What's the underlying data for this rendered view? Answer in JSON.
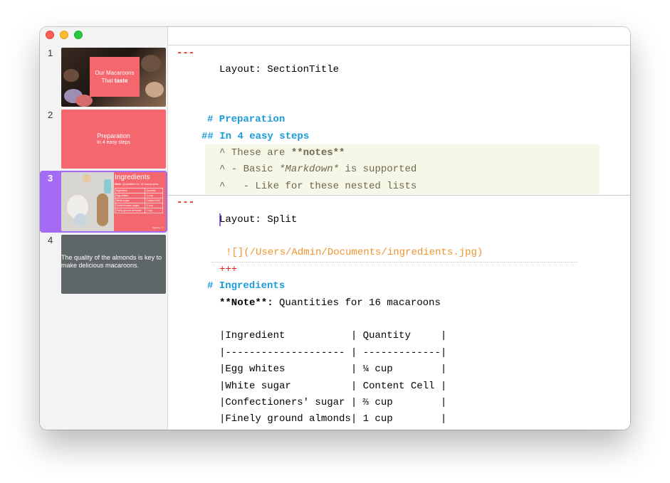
{
  "window": {
    "traffic_lights": [
      "close",
      "minimize",
      "maximize"
    ]
  },
  "slides": [
    {
      "number": "1",
      "title": "Our Macaroons",
      "subtitle_prefix": "That ",
      "subtitle_bold": "taste"
    },
    {
      "number": "2",
      "title": "Preparation",
      "subtitle": "In 4 easy steps"
    },
    {
      "number": "3",
      "title": "Ingredients",
      "note_bold": "Note",
      "note": ": Quantities for 16 macaroons",
      "table": {
        "headers": [
          "Ingredient",
          "Quantity"
        ],
        "rows": [
          [
            "Egg whites",
            "¼ cup"
          ],
          [
            "White sugar",
            "Content Cell"
          ],
          [
            "Confectioners' sugar",
            "⅔ cup"
          ],
          [
            "Finely ground almonds",
            "1 cup"
          ]
        ]
      },
      "footer": "Agenda · 3"
    },
    {
      "number": "4",
      "text": "The quality of the almonds is key to make delicious macaroons."
    }
  ],
  "editor": {
    "l1": "---",
    "l2": "Layout: SectionTitle",
    "l3": "# Preparation",
    "l4": "## In 4 easy steps",
    "n1_pre": "^ These are ",
    "n1_bold": "**notes**",
    "n2_pre": "^ - Basic ",
    "n2_it": "*Markdown*",
    "n2_post": " is supported",
    "n3": "^   - Like for these nested lists",
    "l5": "---",
    "l6": "Layout: Split",
    "l7": "![](/Users/Admin/Documents/ingredients.jpg)",
    "l8": "+++",
    "l9": "# Ingredients",
    "l10_bold": "**Note**:",
    "l10_rest": " Quantities for 16 macaroons",
    "t0": "|Ingredient           | Quantity     |",
    "t1": "|-------------------- | -------------|",
    "t2": "|Egg whites           | ¼ cup        |",
    "t3": "|White sugar          | Content Cell |",
    "t4": "|Confectioners' sugar | ⅔ cup        |",
    "t5": "|Finely ground almonds| 1 cup        |"
  }
}
